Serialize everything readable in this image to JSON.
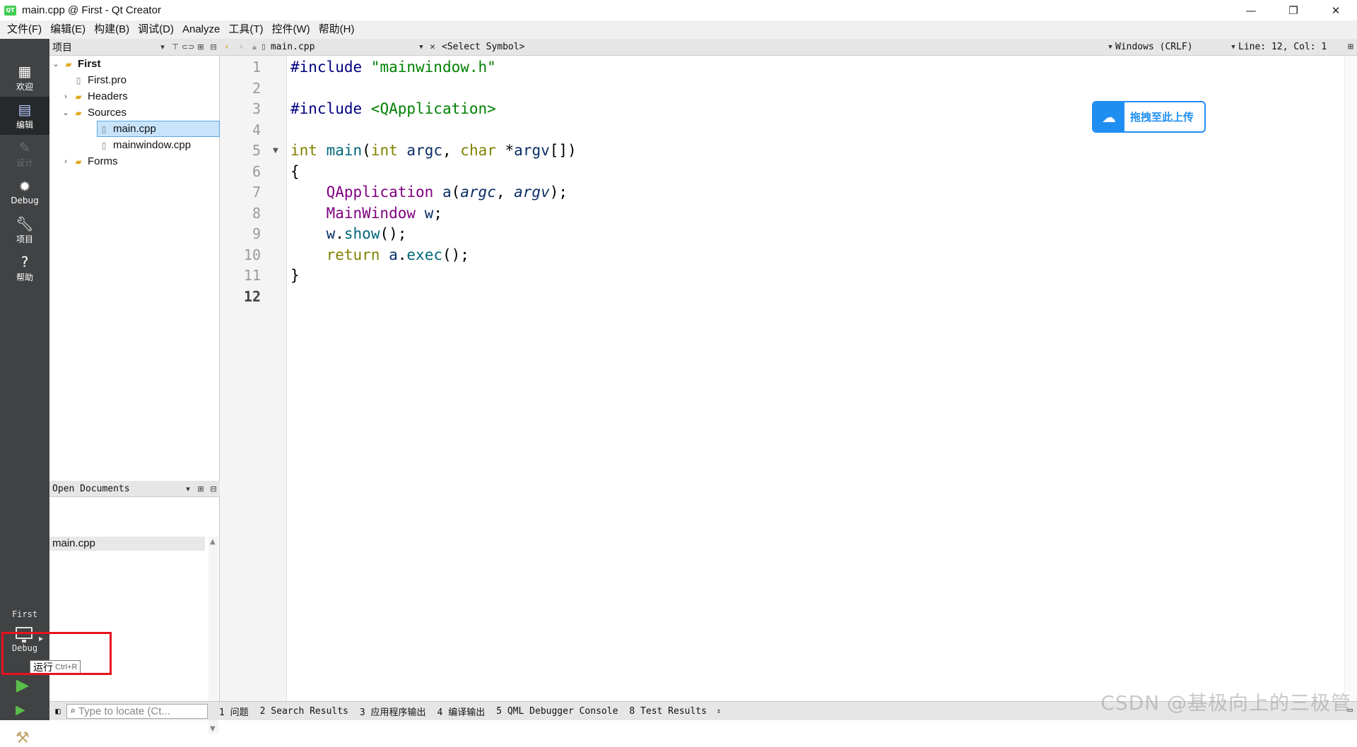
{
  "window": {
    "logo_text": "QT",
    "title": "main.cpp @ First - Qt Creator",
    "minimize": "—",
    "restore": "❐",
    "close": "✕"
  },
  "menu": [
    "文件(F)",
    "编辑(E)",
    "构建(B)",
    "调试(D)",
    "Analyze",
    "工具(T)",
    "控件(W)",
    "帮助(H)"
  ],
  "modes": [
    {
      "label": "欢迎",
      "icon": "grid-icon"
    },
    {
      "label": "编辑",
      "icon": "document-icon"
    },
    {
      "label": "设计",
      "icon": "pencil-icon"
    },
    {
      "label": "Debug",
      "icon": "bug-icon"
    },
    {
      "label": "项目",
      "icon": "wrench-icon"
    },
    {
      "label": "帮助",
      "icon": "help-icon"
    }
  ],
  "target": {
    "project": "First",
    "config": "Debug"
  },
  "run": {
    "tooltip": "运行",
    "shortcut": "Ctrl+R"
  },
  "projects_pane": {
    "title": "项目",
    "tree": [
      {
        "label": "First",
        "indent": 0,
        "arrow": "expanded",
        "icon": "project-folder-icon"
      },
      {
        "label": "First.pro",
        "indent": 1,
        "arrow": "none",
        "icon": "pro-file-icon"
      },
      {
        "label": "Headers",
        "indent": 1,
        "arrow": "collapsed",
        "icon": "headers-folder-icon"
      },
      {
        "label": "Sources",
        "indent": 1,
        "arrow": "expanded",
        "icon": "sources-folder-icon"
      },
      {
        "label": "main.cpp",
        "indent": 2,
        "arrow": "none",
        "icon": "cpp-file-icon",
        "selected": true
      },
      {
        "label": "mainwindow.cpp",
        "indent": 2,
        "arrow": "none",
        "icon": "cpp-file-icon"
      },
      {
        "label": "Forms",
        "indent": 1,
        "arrow": "collapsed",
        "icon": "forms-folder-icon"
      }
    ]
  },
  "open_documents": {
    "title": "Open Documents",
    "items": [
      "main.cpp"
    ]
  },
  "editor": {
    "file": "main.cpp",
    "symbol": "<Select Symbol>",
    "encoding": "Windows (CRLF)",
    "position": "Line: 12, Col: 1",
    "current_line": 12,
    "fold_line": 5,
    "lines": [
      [
        [
          "k-pre",
          "#include "
        ],
        [
          "k-str",
          "\"mainwindow.h\""
        ]
      ],
      [],
      [
        [
          "k-pre",
          "#include "
        ],
        [
          "k-str",
          "<QApplication>"
        ]
      ],
      [],
      [
        [
          "k-type",
          "int"
        ],
        [
          "",
          " "
        ],
        [
          "k-fn",
          "main"
        ],
        [
          "",
          "("
        ],
        [
          "k-type",
          "int"
        ],
        [
          "",
          " "
        ],
        [
          "k-param",
          "argc"
        ],
        [
          "",
          ", "
        ],
        [
          "k-type",
          "char"
        ],
        [
          "",
          " *"
        ],
        [
          "k-param",
          "argv"
        ],
        [
          "",
          "[])"
        ]
      ],
      [
        [
          "",
          "{"
        ]
      ],
      [
        [
          "",
          "    "
        ],
        [
          "k-cls",
          "QApplication"
        ],
        [
          "",
          " "
        ],
        [
          "k-var",
          "a"
        ],
        [
          "",
          "("
        ],
        [
          "k-it",
          "argc"
        ],
        [
          "",
          ", "
        ],
        [
          "k-it",
          "argv"
        ],
        [
          "",
          ");"
        ]
      ],
      [
        [
          "",
          "    "
        ],
        [
          "k-cls",
          "MainWindow"
        ],
        [
          "",
          " "
        ],
        [
          "k-var",
          "w"
        ],
        [
          "",
          ";"
        ]
      ],
      [
        [
          "",
          "    "
        ],
        [
          "k-var",
          "w"
        ],
        [
          "",
          "."
        ],
        [
          "k-fn",
          "show"
        ],
        [
          "",
          "();"
        ]
      ],
      [
        [
          "",
          "    "
        ],
        [
          "k-type",
          "return"
        ],
        [
          "",
          " "
        ],
        [
          "k-var",
          "a"
        ],
        [
          "",
          "."
        ],
        [
          "k-fn",
          "exec"
        ],
        [
          "",
          "();"
        ]
      ],
      [
        [
          "",
          "}"
        ]
      ],
      []
    ]
  },
  "upload_badge": {
    "text": "拖拽至此上传",
    "icon": "cloud-upload-icon"
  },
  "statusbar": {
    "locator_placeholder": "Type to locate (Ct...",
    "tabs": [
      "1 问题",
      "2 Search Results",
      "3 应用程序输出",
      "4 编译输出",
      "5 QML Debugger Console",
      "8 Test Results"
    ]
  },
  "watermark": "CSDN @基极向上的三极管",
  "colors": {
    "highlight": "#e8121e",
    "accent": "#1f8ef1",
    "run": "#5bbd4a",
    "modebar": "#404244"
  }
}
